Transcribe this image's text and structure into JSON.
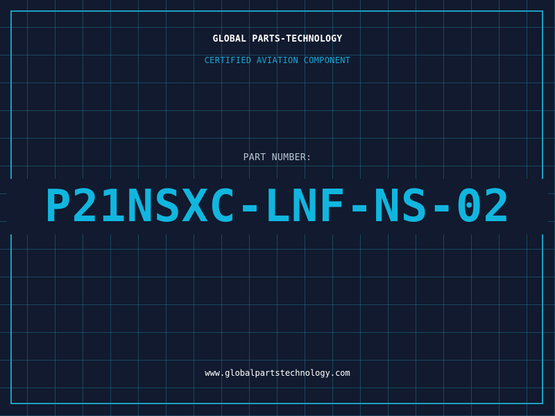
{
  "header": {
    "company": "GLOBAL PARTS-TECHNOLOGY",
    "tagline": "CERTIFIED AVIATION COMPONENT"
  },
  "part": {
    "label": "PART NUMBER:",
    "number": "P21NSXC-LNF-NS-02"
  },
  "footer": {
    "website": "www.globalpartstechnology.com"
  },
  "colors": {
    "background": "#111a2e",
    "grid": "#206e87",
    "accent": "#11b6df",
    "frame": "#1d9fc3"
  }
}
